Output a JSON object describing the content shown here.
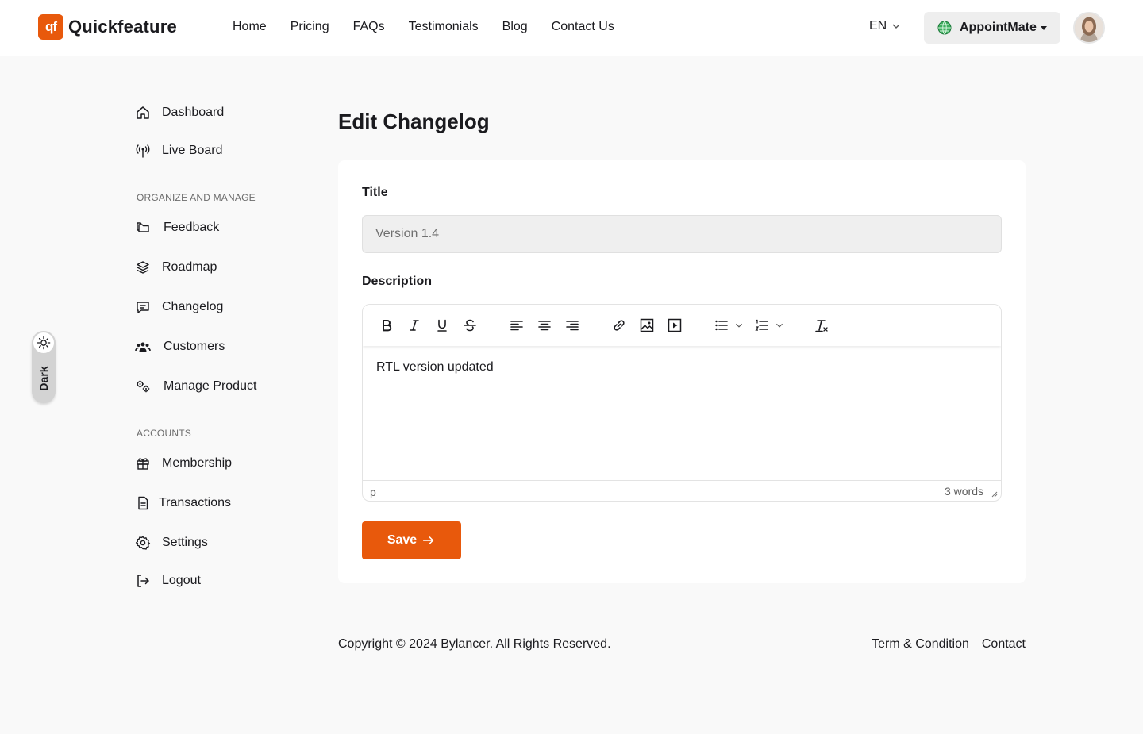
{
  "brand": {
    "logo_mark": "qf",
    "name": "Quickfeature",
    "accent": "#e8590c"
  },
  "nav": [
    "Home",
    "Pricing",
    "FAQs",
    "Testimonials",
    "Blog",
    "Contact Us"
  ],
  "language": "EN",
  "workspace": {
    "name": "AppointMate",
    "icon": "globe-icon"
  },
  "theme_toggle": {
    "label": "Dark",
    "icon": "sun-icon"
  },
  "sidebar": {
    "items_top": [
      {
        "label": "Dashboard",
        "icon": "home-icon"
      },
      {
        "label": "Live Board",
        "icon": "broadcast-icon"
      }
    ],
    "section_organize": "ORGANIZE AND MANAGE",
    "items_organize": [
      {
        "label": "Feedback",
        "icon": "folders-icon"
      },
      {
        "label": "Roadmap",
        "icon": "layers-icon"
      },
      {
        "label": "Changelog",
        "icon": "message-square-icon"
      },
      {
        "label": "Customers",
        "icon": "users-icon"
      },
      {
        "label": "Manage Product",
        "icon": "gears-icon"
      }
    ],
    "section_accounts": "ACCOUNTS",
    "items_accounts": [
      {
        "label": "Membership",
        "icon": "gift-icon"
      },
      {
        "label": "Transactions",
        "icon": "file-text-icon"
      },
      {
        "label": "Settings",
        "icon": "settings-icon"
      },
      {
        "label": "Logout",
        "icon": "logout-icon"
      }
    ]
  },
  "page_title": "Edit Changelog",
  "form": {
    "title_label": "Title",
    "title_value": "Version 1.4",
    "description_label": "Description",
    "description_text": "RTL version updated",
    "status_path": "p",
    "word_count": "3 words",
    "save_label": "Save"
  },
  "toolbar": [
    "bold",
    "italic",
    "underline",
    "strikethrough",
    "align-left",
    "align-center",
    "align-right",
    "link",
    "image",
    "media",
    "bullet-list",
    "numbered-list",
    "clear-formatting"
  ],
  "footer": {
    "copyright": "Copyright © 2024 Bylancer. All Rights Reserved.",
    "links": [
      "Term & Condition",
      "Contact"
    ]
  }
}
